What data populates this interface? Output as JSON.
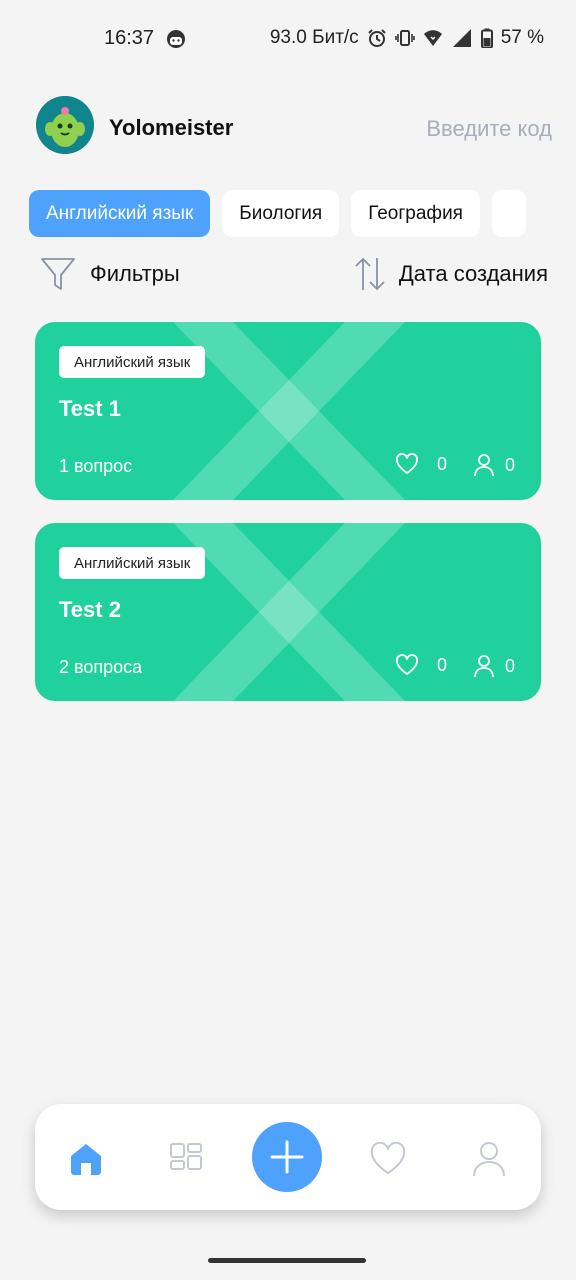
{
  "status_bar": {
    "time": "16:37",
    "speed": "93.0 Бит/с",
    "battery": "57 %"
  },
  "header": {
    "username": "Yolomeister",
    "code_placeholder": "Введите код"
  },
  "categories": {
    "items": [
      "Английский язык",
      "Биология",
      "География",
      ""
    ],
    "active_index": 0
  },
  "toolbar": {
    "filters_label": "Фильтры",
    "sort_label": "Дата создания"
  },
  "tests": [
    {
      "subject": "Английский язык",
      "title": "Test 1",
      "questions": "1 вопрос",
      "likes": "0",
      "users": "0"
    },
    {
      "subject": "Английский язык",
      "title": "Test 2",
      "questions": "2 вопроса",
      "likes": "0",
      "users": "0"
    }
  ],
  "icons": {
    "nav": [
      "home-icon",
      "grid-icon",
      "add-icon",
      "heart-icon",
      "profile-icon"
    ]
  },
  "colors": {
    "accent": "#4ea2fb",
    "card": "#20d19e",
    "background": "#f4f4f4"
  }
}
